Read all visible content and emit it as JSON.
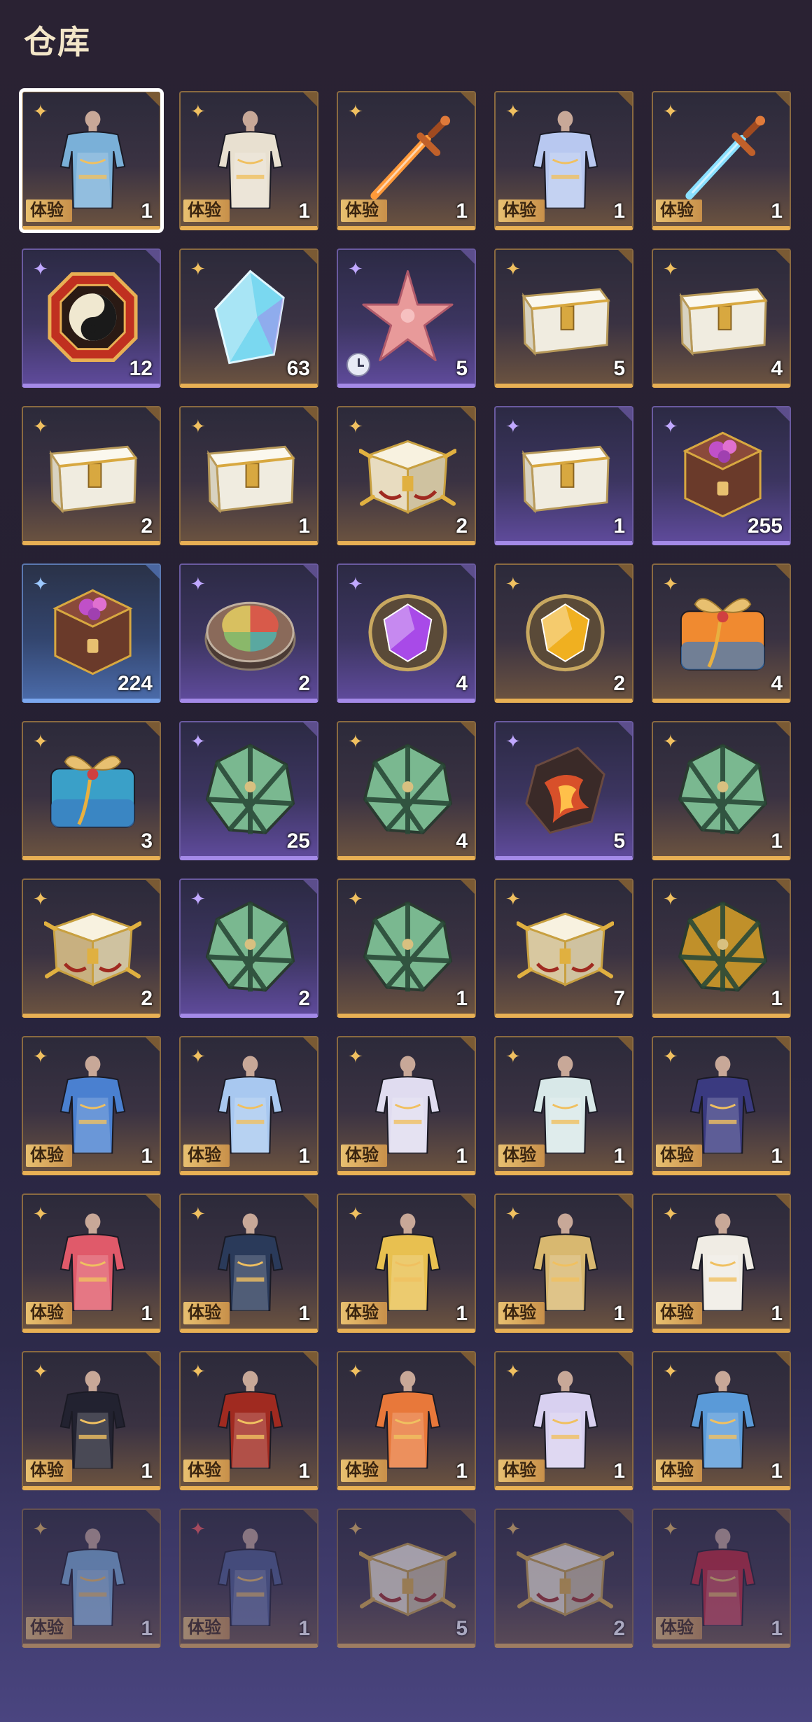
{
  "header": {
    "title": "仓库"
  },
  "slot_labels": {
    "trial": "体验"
  },
  "colors": {
    "gold_border": "#e8b054",
    "purple_border": "#a48ae8",
    "blue_border": "#7ca8f0",
    "selected_outline": "#ffffff"
  },
  "items": [
    {
      "name": "outfit-floral-robe",
      "qty": "1",
      "rarity": "gold",
      "trial": true,
      "art": "outfit",
      "hue": "#7ab0d8",
      "selected": true
    },
    {
      "name": "outfit-white-gold-armor",
      "qty": "1",
      "rarity": "gold",
      "trial": true,
      "art": "outfit",
      "hue": "#e8e0d0"
    },
    {
      "name": "weapon-orange-sword",
      "qty": "1",
      "rarity": "gold",
      "trial": true,
      "art": "sword",
      "hue": "#ff9a3a"
    },
    {
      "name": "outfit-blue-porcelain-dress",
      "qty": "1",
      "rarity": "gold",
      "trial": true,
      "art": "outfit",
      "hue": "#b8c8f0"
    },
    {
      "name": "weapon-ice-sword",
      "qty": "1",
      "rarity": "gold",
      "trial": true,
      "art": "sword",
      "hue": "#8ae0ff"
    },
    {
      "name": "token-yin-yang-medallion",
      "qty": "12",
      "rarity": "purple",
      "art": "medallion",
      "hue": "#c03020"
    },
    {
      "name": "crystal-shard",
      "qty": "63",
      "rarity": "gold",
      "art": "crystal",
      "hue": "#7ad8f0"
    },
    {
      "name": "starfish-material",
      "qty": "5",
      "rarity": "purple",
      "art": "starfish",
      "hue": "#e89a9a",
      "timed": true
    },
    {
      "name": "white-jade-chest",
      "qty": "5",
      "rarity": "gold",
      "art": "chest",
      "hue": "#f0ece0"
    },
    {
      "name": "white-jade-chest",
      "qty": "4",
      "rarity": "gold",
      "art": "chest",
      "hue": "#f0ece0"
    },
    {
      "name": "white-jade-chest",
      "qty": "2",
      "rarity": "gold",
      "art": "chest",
      "hue": "#f0ece0"
    },
    {
      "name": "white-jade-chest",
      "qty": "1",
      "rarity": "gold",
      "art": "chest",
      "hue": "#f0ece0"
    },
    {
      "name": "ornate-gold-chest",
      "qty": "2",
      "rarity": "gold",
      "art": "ornate-chest",
      "hue": "#e8dcc0"
    },
    {
      "name": "white-jade-chest",
      "qty": "1",
      "rarity": "purple",
      "art": "chest",
      "hue": "#f0ece0"
    },
    {
      "name": "lacquer-hex-box",
      "qty": "255",
      "rarity": "purple",
      "art": "hexbox",
      "hue": "#6a3a2a"
    },
    {
      "name": "lacquer-hex-box",
      "qty": "224",
      "rarity": "blue",
      "art": "hexbox",
      "hue": "#6a3a2a"
    },
    {
      "name": "jade-compass-disc",
      "qty": "2",
      "rarity": "purple",
      "art": "disc",
      "hue": "#8a6a5a"
    },
    {
      "name": "purple-gem-relic",
      "qty": "4",
      "rarity": "purple",
      "art": "gem",
      "hue": "#a84ae8"
    },
    {
      "name": "gold-gem-relic",
      "qty": "2",
      "rarity": "gold",
      "art": "gem",
      "hue": "#f0b020"
    },
    {
      "name": "orange-gift-bundle",
      "qty": "4",
      "rarity": "gold",
      "art": "gift",
      "hue": "#f08a30"
    },
    {
      "name": "blue-gift-bundle",
      "qty": "3",
      "rarity": "gold",
      "art": "gift",
      "hue": "#3aa0c8"
    },
    {
      "name": "jade-polyhedron",
      "qty": "25",
      "rarity": "purple",
      "art": "poly",
      "hue": "#7ab890"
    },
    {
      "name": "jade-polyhedron",
      "qty": "4",
      "rarity": "gold",
      "art": "poly",
      "hue": "#7ab890"
    },
    {
      "name": "ember-stone",
      "qty": "5",
      "rarity": "purple",
      "art": "ember",
      "hue": "#d8502a"
    },
    {
      "name": "jade-polyhedron",
      "qty": "1",
      "rarity": "gold",
      "art": "poly",
      "hue": "#7ab890"
    },
    {
      "name": "ornate-gold-chest",
      "qty": "2",
      "rarity": "gold",
      "art": "ornate-chest",
      "hue": "#c8b080"
    },
    {
      "name": "jade-polyhedron",
      "qty": "2",
      "rarity": "purple",
      "art": "poly",
      "hue": "#7ab890"
    },
    {
      "name": "jade-polyhedron",
      "qty": "1",
      "rarity": "gold",
      "art": "poly",
      "hue": "#7ab890"
    },
    {
      "name": "ornate-gold-chest",
      "qty": "7",
      "rarity": "gold",
      "art": "ornate-chest",
      "hue": "#d8c8a0"
    },
    {
      "name": "red-gold-polyhedron",
      "qty": "1",
      "rarity": "gold",
      "art": "poly",
      "hue": "#c0902a"
    },
    {
      "name": "outfit-blue-white-gown",
      "qty": "1",
      "rarity": "gold",
      "trial": true,
      "art": "outfit",
      "hue": "#4a80d0"
    },
    {
      "name": "outfit-pale-blue-dress",
      "qty": "1",
      "rarity": "gold",
      "trial": true,
      "art": "outfit",
      "hue": "#a8c8f0"
    },
    {
      "name": "outfit-white-fur-coat",
      "qty": "1",
      "rarity": "gold",
      "trial": true,
      "art": "outfit",
      "hue": "#e0dcf0"
    },
    {
      "name": "outfit-white-teal-coat",
      "qty": "1",
      "rarity": "gold",
      "trial": true,
      "art": "outfit",
      "hue": "#d8e8e8"
    },
    {
      "name": "outfit-navy-gown",
      "qty": "1",
      "rarity": "gold",
      "trial": true,
      "art": "outfit",
      "hue": "#3a3a80"
    },
    {
      "name": "outfit-red-white-dress",
      "qty": "1",
      "rarity": "gold",
      "trial": true,
      "art": "outfit",
      "hue": "#e05a6a"
    },
    {
      "name": "outfit-dark-armor-dress",
      "qty": "1",
      "rarity": "gold",
      "trial": true,
      "art": "outfit",
      "hue": "#2a3a5a"
    },
    {
      "name": "outfit-gold-black-dress",
      "qty": "1",
      "rarity": "gold",
      "trial": true,
      "art": "outfit",
      "hue": "#e8c050"
    },
    {
      "name": "outfit-gold-cape-armor",
      "qty": "1",
      "rarity": "gold",
      "trial": true,
      "art": "outfit",
      "hue": "#d8b870"
    },
    {
      "name": "outfit-white-robe",
      "qty": "1",
      "rarity": "gold",
      "trial": true,
      "art": "outfit",
      "hue": "#f0ece4"
    },
    {
      "name": "outfit-black-vest",
      "qty": "1",
      "rarity": "gold",
      "trial": true,
      "art": "outfit",
      "hue": "#222230"
    },
    {
      "name": "outfit-red-cape-armor",
      "qty": "1",
      "rarity": "gold",
      "trial": true,
      "art": "outfit",
      "hue": "#a02a20"
    },
    {
      "name": "outfit-orange-white-armor",
      "qty": "1",
      "rarity": "gold",
      "trial": true,
      "art": "outfit",
      "hue": "#e8783a"
    },
    {
      "name": "outfit-white-purple-dress",
      "qty": "1",
      "rarity": "gold",
      "trial": true,
      "art": "outfit",
      "hue": "#d8d0f0"
    },
    {
      "name": "outfit-blue-shawl-dress",
      "qty": "1",
      "rarity": "gold",
      "trial": true,
      "art": "outfit",
      "hue": "#5a9ad8"
    },
    {
      "name": "outfit-floral-robe",
      "qty": "1",
      "rarity": "gold",
      "trial": true,
      "art": "outfit",
      "hue": "#7ab0d8",
      "fade": true
    },
    {
      "name": "outfit-fur-armor",
      "qty": "1",
      "rarity": "gold",
      "trial": true,
      "art": "outfit",
      "hue": "#4a5a8a",
      "fade": true,
      "rarityMark": "red"
    },
    {
      "name": "ornate-gold-chest",
      "qty": "5",
      "rarity": "gold",
      "art": "ornate-chest",
      "hue": "#f0e8d0",
      "fade": true
    },
    {
      "name": "ornate-gold-chest",
      "qty": "2",
      "rarity": "gold",
      "art": "ornate-chest",
      "hue": "#f0e8d0",
      "fade": true
    },
    {
      "name": "outfit-red-halter-dress",
      "qty": "1",
      "rarity": "gold",
      "trial": true,
      "art": "outfit",
      "hue": "#c02030",
      "fade": true
    }
  ]
}
